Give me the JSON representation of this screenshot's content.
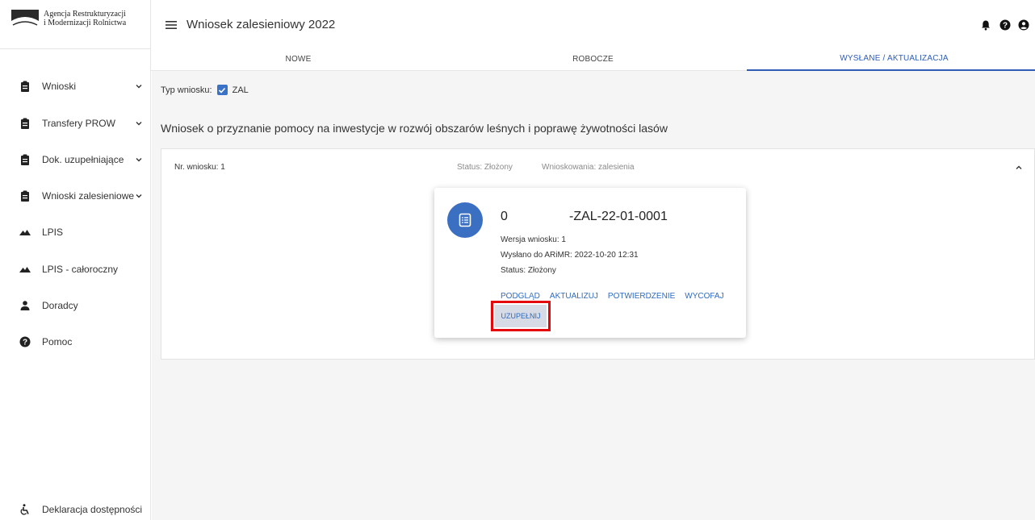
{
  "branding": {
    "logo_line1": "Agencja Restrukturyzacji",
    "logo_line2": "i Modernizacji Rolnictwa"
  },
  "header": {
    "title": "Wniosek zalesieniowy 2022"
  },
  "sidebar": {
    "items": [
      {
        "label": "Wnioski",
        "icon": "clipboard-icon",
        "has_submenu": true
      },
      {
        "label": "Transfery PROW",
        "icon": "clipboard-icon",
        "has_submenu": true
      },
      {
        "label": "Dok. uzupełniające",
        "icon": "clipboard-icon",
        "has_submenu": true
      },
      {
        "label": "Wnioski zalesieniowe",
        "icon": "clipboard-icon",
        "has_submenu": true
      },
      {
        "label": "LPIS",
        "icon": "terrain-icon",
        "has_submenu": false
      },
      {
        "label": "LPIS - całoroczny",
        "icon": "terrain-icon",
        "has_submenu": false
      },
      {
        "label": "Doradcy",
        "icon": "person-icon",
        "has_submenu": false
      },
      {
        "label": "Pomoc",
        "icon": "help-circle-icon",
        "has_submenu": false
      }
    ],
    "footer_label": "Deklaracja dostępności"
  },
  "tabs": [
    {
      "label": "NOWE",
      "active": false
    },
    {
      "label": "ROBOCZE",
      "active": false
    },
    {
      "label": "WYSŁANE / AKTUALIZACJA",
      "active": true
    }
  ],
  "filter": {
    "label": "Typ wniosku:",
    "checkbox_label": "ZAL",
    "checked": true
  },
  "section_heading": "Wniosek o przyznanie pomocy na inwestycje w rozwój obszarów leśnych i poprawę żywotności lasów",
  "panel": {
    "nr": "Nr. wniosku: 1",
    "status": "Status: Złożony",
    "type": "Wnioskowania: zalesienia"
  },
  "card": {
    "id_prefix": "0",
    "id_suffix": "-ZAL-22-01-0001",
    "version": "Wersja wniosku: 1",
    "sent": "Wysłano do ARiMR: 2022-10-20 12:31",
    "status": "Status: Złożony",
    "actions": {
      "preview": "PODGLĄD",
      "update": "AKTUALIZUJ",
      "confirm": "POTWIERDZENIE",
      "withdraw": "WYCOFAJ",
      "supplement": "UZUPEŁNIJ"
    }
  },
  "colors": {
    "accent": "#2f5db6",
    "avatar": "#3a6fc1",
    "highlight": "#e4080d"
  }
}
